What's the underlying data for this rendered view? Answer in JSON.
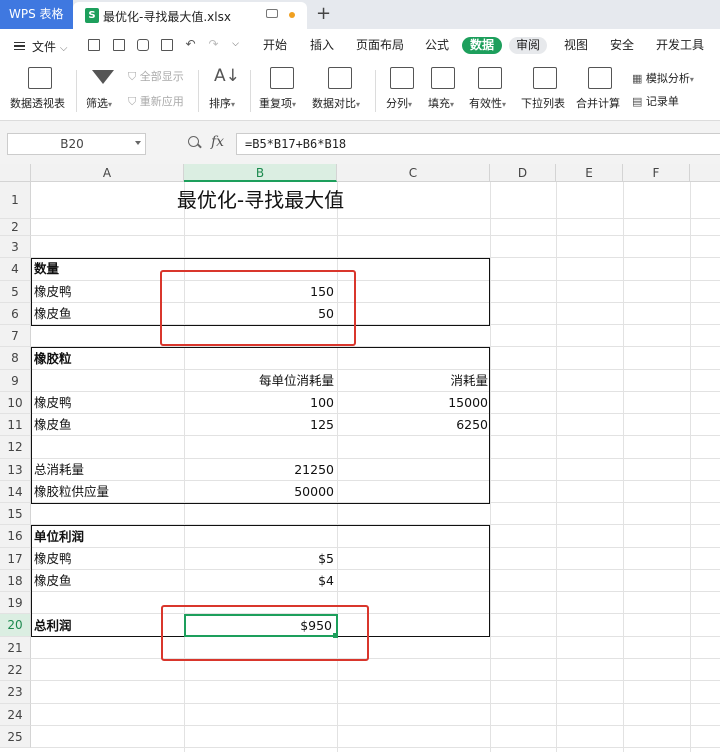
{
  "app": {
    "name": "WPS 表格"
  },
  "document": {
    "title": "最优化-寻找最大值.xlsx"
  },
  "menubar": {
    "file_label": "文件",
    "tabs": [
      {
        "id": "home",
        "label": "开始"
      },
      {
        "id": "insert",
        "label": "插入"
      },
      {
        "id": "layout",
        "label": "页面布局"
      },
      {
        "id": "formula",
        "label": "公式"
      },
      {
        "id": "data",
        "label": "数据",
        "active": true
      },
      {
        "id": "review",
        "label": "审阅"
      },
      {
        "id": "view",
        "label": "视图"
      },
      {
        "id": "security",
        "label": "安全"
      },
      {
        "id": "dev",
        "label": "开发工具"
      }
    ]
  },
  "ribbon": {
    "pivot": "数据透视表",
    "filter": "筛选",
    "show_all": "全部显示",
    "reapply": "重新应用",
    "sort": "排序",
    "duplicates": "重复项",
    "compare": "数据对比",
    "split": "分列",
    "fill": "填充",
    "validation": "有效性",
    "dropdown": "下拉列表",
    "consolidate": "合并计算",
    "whatif": "模拟分析",
    "record": "记录单"
  },
  "formula_bar": {
    "cell_ref": "B20",
    "formula": "=B5*B17+B6*B18",
    "fx": "fx"
  },
  "columns": [
    "A",
    "B",
    "C",
    "D",
    "E",
    "F"
  ],
  "selected_column": "B",
  "rows": [
    "1",
    "2",
    "3",
    "4",
    "5",
    "6",
    "7",
    "8",
    "9",
    "10",
    "11",
    "12",
    "13",
    "14",
    "15",
    "16",
    "17",
    "18",
    "19",
    "20",
    "21",
    "22",
    "23",
    "24",
    "25"
  ],
  "selected_row": "20",
  "sheet": {
    "title": "最优化-寻找最大值",
    "qty_header": "数量",
    "qty_duck_label": "橡皮鸭",
    "qty_duck_val": "150",
    "qty_fish_label": "橡皮鱼",
    "qty_fish_val": "50",
    "rubber_header": "橡胶粒",
    "per_unit_header": "每单位消耗量",
    "consumption_header": "消耗量",
    "duck_label": "橡皮鸭",
    "duck_per_unit": "100",
    "duck_consumption": "15000",
    "fish_label": "橡皮鱼",
    "fish_per_unit": "125",
    "fish_consumption": "6250",
    "total_consumption_label": "总消耗量",
    "total_consumption_val": "21250",
    "supply_label": "橡胶粒供应量",
    "supply_val": "50000",
    "profit_header": "单位利润",
    "profit_duck_label": "橡皮鸭",
    "profit_duck_val": "$5",
    "profit_fish_label": "橡皮鱼",
    "profit_fish_val": "$4",
    "total_profit_label": "总利润",
    "total_profit_val": "$950"
  }
}
